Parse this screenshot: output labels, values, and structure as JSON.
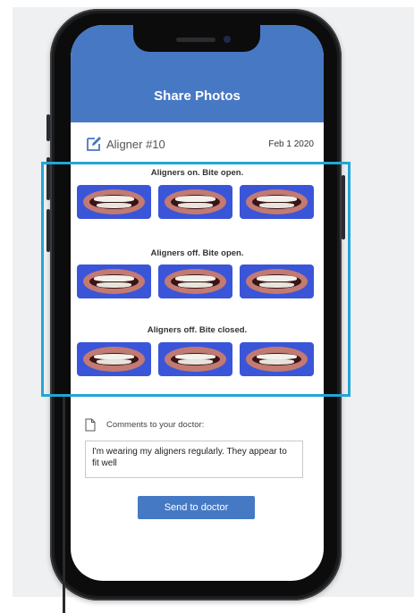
{
  "header": {
    "title": "Share Photos"
  },
  "aligner": {
    "name": "Aligner #10",
    "date": "Feb 1 2020"
  },
  "sections": [
    {
      "title": "Aligners on. Bite open."
    },
    {
      "title": "Aligners off. Bite open."
    },
    {
      "title": "Aligners off. Bite closed."
    }
  ],
  "comments": {
    "label": "Comments to your doctor:",
    "value": "I'm wearing my aligners regularly. They appear to fit well"
  },
  "send_button": {
    "label": "Send to doctor"
  },
  "colors": {
    "header": "#4778c3",
    "button": "#4679c4",
    "highlight": "#23a5d6",
    "photo_background": "#3b55d8"
  },
  "icons": [
    "edit-icon",
    "document-icon"
  ]
}
